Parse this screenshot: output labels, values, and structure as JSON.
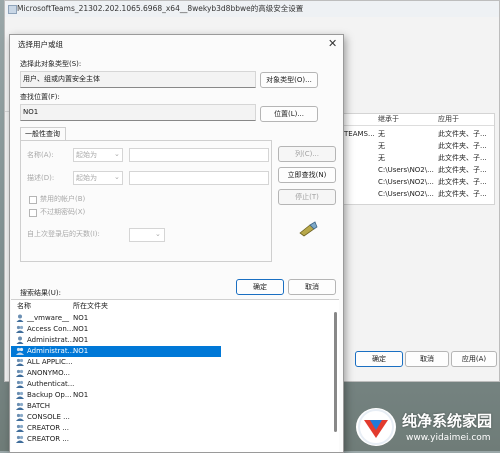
{
  "background_window": {
    "title": "MicrosoftTeams_21302.202.1065.6968_x64__8wekyb3d8bbwe的高级安全设置",
    "table": {
      "headers": [
        "继承于",
        "应用于"
      ],
      "left_fragment": "TEAMS...",
      "rows": [
        [
          "无",
          "此文件夹、子..."
        ],
        [
          "无",
          "此文件夹、子..."
        ],
        [
          "无",
          "此文件夹、子..."
        ],
        [
          "C:\\Users\\NO2\\...",
          "此文件夹、子..."
        ],
        [
          "C:\\Users\\NO2\\...",
          "此文件夹、子..."
        ],
        [
          "C:\\Users\\NO2\\...",
          "此文件夹、子..."
        ]
      ]
    },
    "buttons": {
      "ok": "确定",
      "cancel": "取消",
      "apply": "应用(A)"
    }
  },
  "dialog": {
    "title": "选择用户或组",
    "object_type_label": "选择此对象类型(S):",
    "object_type_value": "用户、组或内置安全主体",
    "object_type_button": "对象类型(O)...",
    "location_label": "查找位置(F):",
    "location_value": "NO1",
    "location_button": "位置(L)...",
    "tab_general": "一般性查询",
    "name_label": "名称(A):",
    "name_mode": "起始为",
    "desc_label": "描述(D):",
    "desc_mode": "起始为",
    "disabled_accounts": "禁用的帐户(B)",
    "nonexpiring_pw": "不过期密码(X)",
    "days_since_logon": "自上次登录后的天数(I):",
    "columns_button": "列(C)...",
    "find_now_button": "立即查找(N)",
    "stop_button": "停止(T)",
    "ok_button": "确定",
    "cancel_button": "取消",
    "results_label": "搜索结果(U):",
    "results_headers": [
      "名称",
      "所在文件夹"
    ],
    "results": [
      {
        "name": "__vmware__",
        "folder": "NO1"
      },
      {
        "name": "Access Con...",
        "folder": "NO1"
      },
      {
        "name": "Administrat...",
        "folder": "NO1"
      },
      {
        "name": "Administrat...",
        "folder": "NO1"
      },
      {
        "name": "ALL APPLIC...",
        "folder": ""
      },
      {
        "name": "ANONYMO...",
        "folder": ""
      },
      {
        "name": "Authenticat...",
        "folder": ""
      },
      {
        "name": "Backup Op...",
        "folder": "NO1"
      },
      {
        "name": "BATCH",
        "folder": ""
      },
      {
        "name": "CONSOLE ...",
        "folder": ""
      },
      {
        "name": "CREATOR ...",
        "folder": ""
      },
      {
        "name": "CREATOR ...",
        "folder": ""
      }
    ]
  },
  "watermark": {
    "name": "纯净系统家园",
    "url": "www.yidaimei.com"
  }
}
